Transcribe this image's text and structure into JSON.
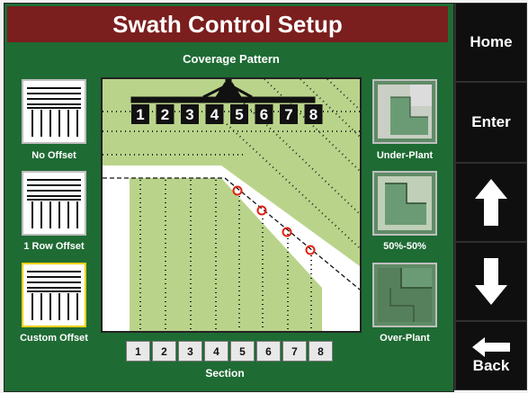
{
  "title": "Swath Control Setup",
  "subtitle": "Coverage Pattern",
  "left_options": [
    {
      "label": "No Offset"
    },
    {
      "label": "1 Row Offset"
    },
    {
      "label": "Custom Offset",
      "selected": true
    }
  ],
  "right_options": [
    {
      "label": "Under-Plant"
    },
    {
      "label": "50%-50%"
    },
    {
      "label": "Over-Plant"
    }
  ],
  "implement_sections": [
    "1",
    "2",
    "3",
    "4",
    "5",
    "6",
    "7",
    "8"
  ],
  "section_buttons": [
    "1",
    "2",
    "3",
    "4",
    "5",
    "6",
    "7",
    "8"
  ],
  "section_label": "Section",
  "nav": {
    "home": "Home",
    "enter": "Enter",
    "up_icon": "arrow-up-icon",
    "down_icon": "arrow-down-icon",
    "back": "Back",
    "back_icon": "arrow-left-icon"
  },
  "colors": {
    "title_bg": "#7b1e1e",
    "panel_bg": "#1f6b34",
    "crop_green": "#b9d48a",
    "selected_border": "#f2d000"
  }
}
